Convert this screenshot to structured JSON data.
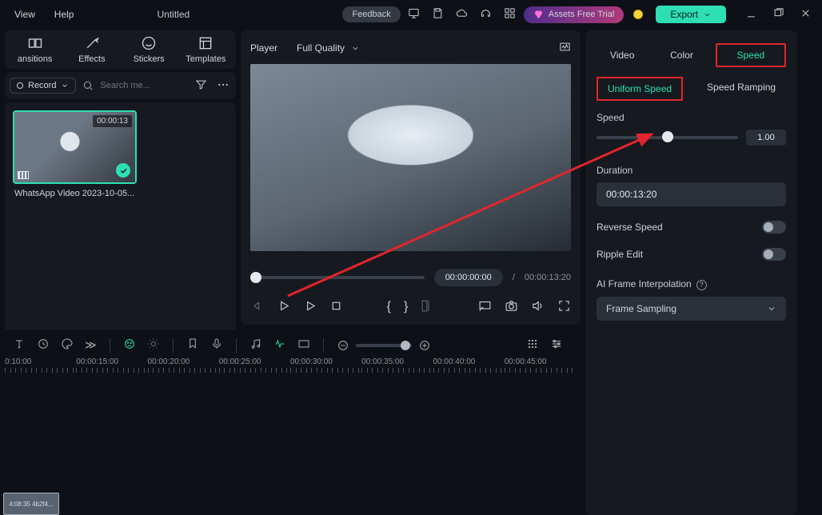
{
  "topbar": {
    "menu_view": "View",
    "menu_help": "Help",
    "title": "Untitled",
    "feedback": "Feedback",
    "assets": "Assets Free Trial",
    "export": "Export"
  },
  "tools": {
    "transitions": "ansitions",
    "effects": "Effects",
    "stickers": "Stickers",
    "templates": "Templates"
  },
  "record": {
    "label": "Record",
    "search_placeholder": "Search me..."
  },
  "media": {
    "thumb_duration": "00:00:13",
    "thumb_label": "WhatsApp Video 2023-10-05..."
  },
  "player": {
    "label": "Player",
    "quality": "Full Quality",
    "time_current": "00:00:00:00",
    "time_sep": "/",
    "time_total": "00:00:13:20"
  },
  "timeline": {
    "marks": [
      "0:10:00",
      "00:00:15:00",
      "00:00:20:00",
      "00:00:25:00",
      "00:00:30:00",
      "00:00:35:00",
      "00:00:40:00",
      "00:00:45:00"
    ],
    "cliplabel": "4:08:35 4b2f4..."
  },
  "right": {
    "tab_video": "Video",
    "tab_color": "Color",
    "tab_speed": "Speed",
    "sub_uniform": "Uniform Speed",
    "sub_ramp": "Speed Ramping",
    "speed_label": "Speed",
    "speed_val": "1.00",
    "duration_label": "Duration",
    "duration_val": "00:00:13:20",
    "reverse": "Reverse Speed",
    "ripple": "Ripple Edit",
    "interp": "AI Frame Interpolation",
    "interp_val": "Frame Sampling"
  }
}
